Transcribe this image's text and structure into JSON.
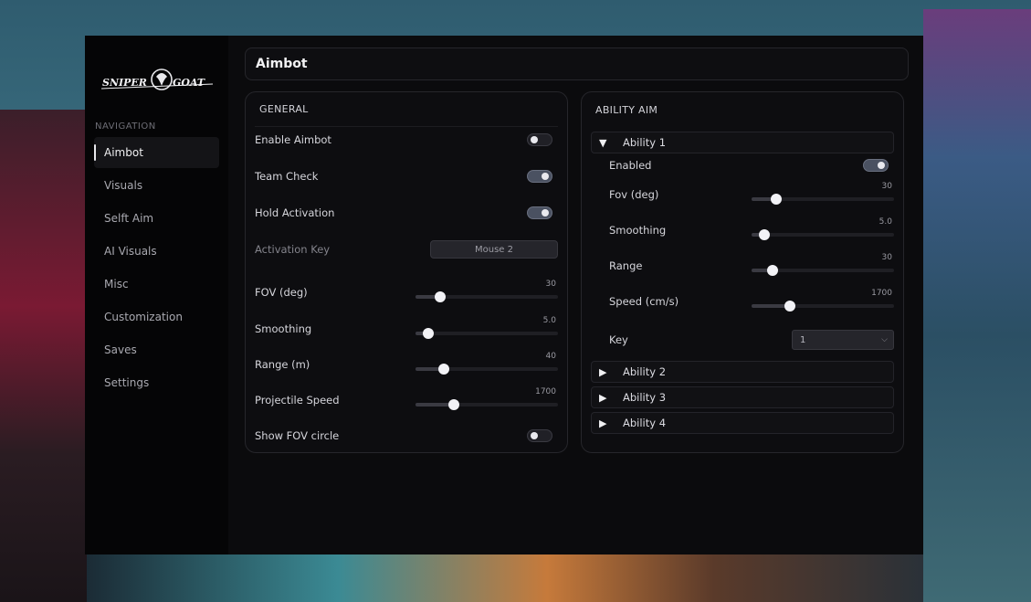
{
  "brand": {
    "logo_text": "SNIPER GOAT"
  },
  "nav": {
    "title": "NAVIGATION",
    "items": [
      "Aimbot",
      "Visuals",
      "Selft Aim",
      "AI Visuals",
      "Misc",
      "Customization",
      "Saves",
      "Settings"
    ],
    "active": "Aimbot"
  },
  "page_title": "Aimbot",
  "general": {
    "header": "GENERAL",
    "enable_aimbot": {
      "label": "Enable Aimbot",
      "on": false
    },
    "team_check": {
      "label": "Team Check",
      "on": true
    },
    "hold_activation": {
      "label": "Hold Activation",
      "on": true
    },
    "activation_key": {
      "label": "Activation Key",
      "value": "Mouse 2"
    },
    "fov": {
      "label": "FOV (deg)",
      "value": "30",
      "fraction": 0.17
    },
    "smoothing": {
      "label": "Smoothing",
      "value": "5.0",
      "fraction": 0.09
    },
    "range": {
      "label": "Range (m)",
      "value": "40",
      "fraction": 0.2
    },
    "projectile_speed": {
      "label": "Projectile Speed",
      "value": "1700",
      "fraction": 0.27
    },
    "show_fov": {
      "label": "Show FOV circle",
      "on": false
    }
  },
  "ability_aim": {
    "header": "ABILITY AIM",
    "ability1": {
      "label": "Ability 1",
      "enabled": {
        "label": "Enabled",
        "on": true
      },
      "fov": {
        "label": "Fov (deg)",
        "value": "30",
        "fraction": 0.17
      },
      "smoothing": {
        "label": "Smoothing",
        "value": "5.0",
        "fraction": 0.09
      },
      "range": {
        "label": "Range",
        "value": "30",
        "fraction": 0.15
      },
      "speed": {
        "label": "Speed (cm/s)",
        "value": "1700",
        "fraction": 0.27
      },
      "key": {
        "label": "Key",
        "value": "1"
      }
    },
    "ability2": {
      "label": "Ability 2"
    },
    "ability3": {
      "label": "Ability 3"
    },
    "ability4": {
      "label": "Ability 4"
    }
  }
}
